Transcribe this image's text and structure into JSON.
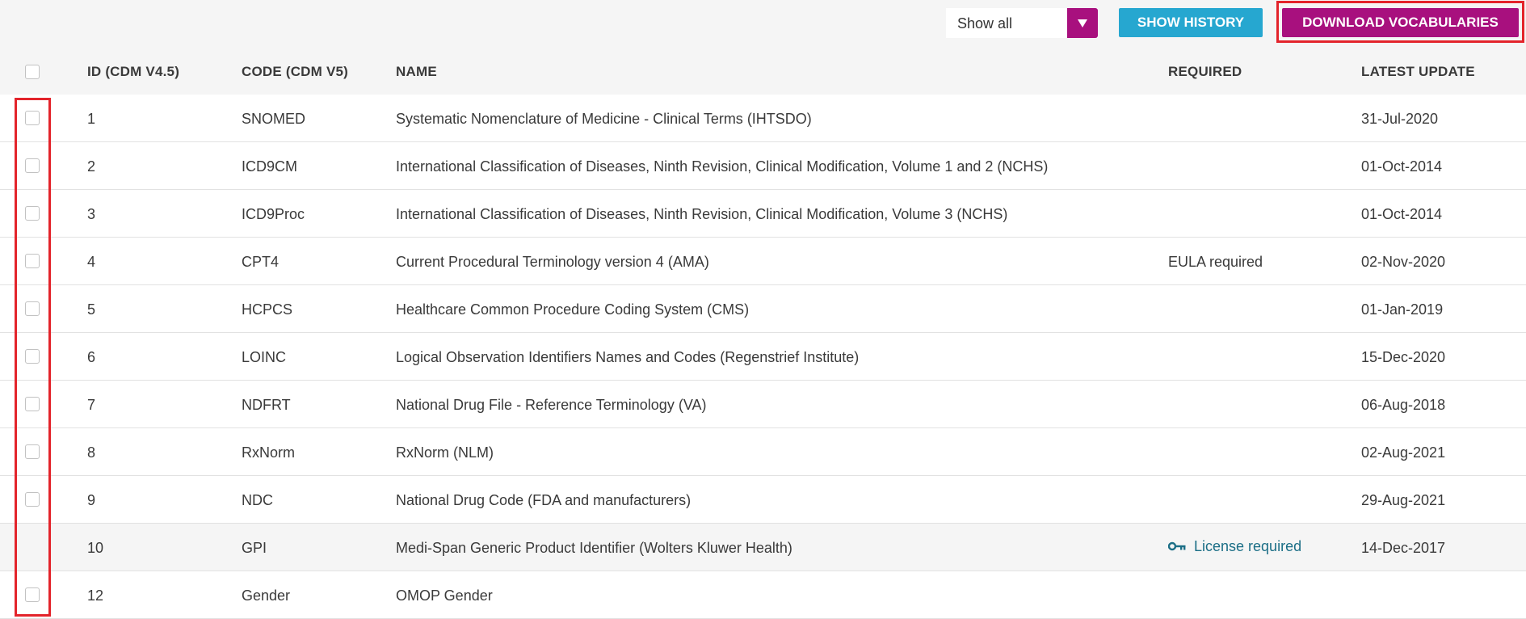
{
  "toolbar": {
    "filter_value": "Show all",
    "show_history_label": "SHOW HISTORY",
    "download_label": "DOWNLOAD VOCABULARIES"
  },
  "table": {
    "columns": [
      "ID (CDM V4.5)",
      "CODE (CDM V5)",
      "NAME",
      "REQUIRED",
      "LATEST UPDATE"
    ],
    "rows": [
      {
        "id": "1",
        "code": "SNOMED",
        "name": "Systematic Nomenclature of Medicine - Clinical Terms (IHTSDO)",
        "required": "",
        "updated": "31-Jul-2020"
      },
      {
        "id": "2",
        "code": "ICD9CM",
        "name": "International Classification of Diseases, Ninth Revision, Clinical Modification, Volume 1 and 2 (NCHS)",
        "required": "",
        "updated": "01-Oct-2014"
      },
      {
        "id": "3",
        "code": "ICD9Proc",
        "name": "International Classification of Diseases, Ninth Revision, Clinical Modification, Volume 3 (NCHS)",
        "required": "",
        "updated": "01-Oct-2014"
      },
      {
        "id": "4",
        "code": "CPT4",
        "name": "Current Procedural Terminology version 4 (AMA)",
        "required": "EULA required",
        "updated": "02-Nov-2020"
      },
      {
        "id": "5",
        "code": "HCPCS",
        "name": "Healthcare Common Procedure Coding System (CMS)",
        "required": "",
        "updated": "01-Jan-2019"
      },
      {
        "id": "6",
        "code": "LOINC",
        "name": "Logical Observation Identifiers Names and Codes (Regenstrief Institute)",
        "required": "",
        "updated": "15-Dec-2020"
      },
      {
        "id": "7",
        "code": "NDFRT",
        "name": "National Drug File - Reference Terminology (VA)",
        "required": "",
        "updated": "06-Aug-2018"
      },
      {
        "id": "8",
        "code": "RxNorm",
        "name": "RxNorm (NLM)",
        "required": "",
        "updated": "02-Aug-2021"
      },
      {
        "id": "9",
        "code": "NDC",
        "name": "National Drug Code (FDA and manufacturers)",
        "required": "",
        "updated": "29-Aug-2021"
      },
      {
        "id": "10",
        "code": "GPI",
        "name": "Medi-Span Generic Product Identifier (Wolters Kluwer Health)",
        "required": "License required",
        "updated": "14-Dec-2017"
      },
      {
        "id": "12",
        "code": "Gender",
        "name": "OMOP Gender",
        "required": "",
        "updated": ""
      }
    ]
  },
  "colors": {
    "accent_magenta": "#a8107e",
    "accent_blue": "#26a7d0",
    "highlight_red": "#e3242b",
    "license_link": "#1b6e86"
  },
  "icons": {
    "filter_dropdown": "triangle-down-icon",
    "license": "key-icon"
  }
}
